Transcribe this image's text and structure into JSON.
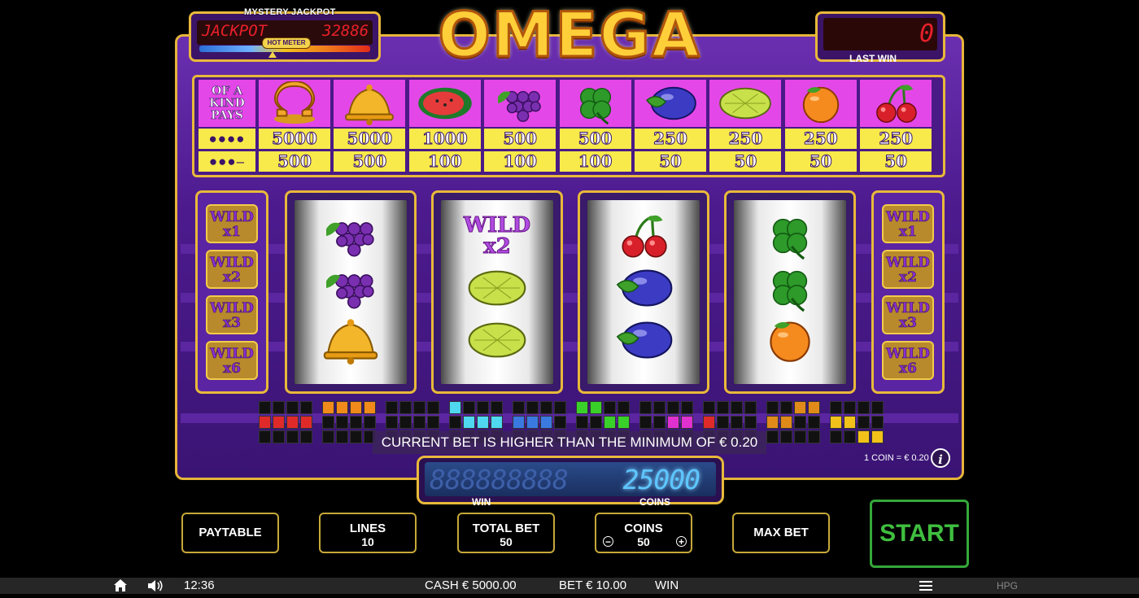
{
  "header": {
    "mystery_jackpot_title": "MYSTERY JACKPOT",
    "jackpot_label": "JACKPOT",
    "jackpot_value": "32886",
    "hot_meter_label": "HOT METER",
    "logo": "OMEGA",
    "last_win_value": "0",
    "last_win_label": "LAST WIN"
  },
  "paytable": {
    "kind_label": "OF A KIND PAYS",
    "row1_marker": "●●●●",
    "row2_marker": "●●●–",
    "symbols": [
      {
        "icon": "omega-icon",
        "five": "5000",
        "four": "500"
      },
      {
        "icon": "bell-icon",
        "five": "5000",
        "four": "500"
      },
      {
        "icon": "watermelon-icon",
        "five": "1000",
        "four": "100"
      },
      {
        "icon": "grapes-icon",
        "five": "500",
        "four": "100"
      },
      {
        "icon": "clover-icon",
        "five": "500",
        "four": "100"
      },
      {
        "icon": "plum-icon",
        "five": "250",
        "four": "50"
      },
      {
        "icon": "lemon-icon",
        "five": "250",
        "four": "50"
      },
      {
        "icon": "orange-icon",
        "five": "250",
        "four": "50"
      },
      {
        "icon": "cherry-icon",
        "five": "250",
        "four": "50"
      }
    ]
  },
  "wild_multipliers": {
    "left": [
      {
        "top": "WILD",
        "bot": "x1"
      },
      {
        "top": "WILD",
        "bot": "x2"
      },
      {
        "top": "WILD",
        "bot": "x3"
      },
      {
        "top": "WILD",
        "bot": "x6"
      }
    ],
    "right": [
      {
        "top": "WILD",
        "bot": "x1"
      },
      {
        "top": "WILD",
        "bot": "x2"
      },
      {
        "top": "WILD",
        "bot": "x3"
      },
      {
        "top": "WILD",
        "bot": "x6"
      }
    ]
  },
  "reels": [
    [
      "grapes-icon",
      "grapes-icon",
      "bell-icon"
    ],
    [
      "wild-x2",
      "lemon-icon",
      "lemon-icon"
    ],
    [
      "cherry-icon",
      "plum-icon",
      "plum-icon"
    ],
    [
      "clover-icon",
      "clover-icon",
      "orange-icon"
    ]
  ],
  "reel_wild": {
    "top": "WILD",
    "bot": "x2"
  },
  "message": "CURRENT BET IS HIGHER THAN THE MINIMUM OF € 0.20",
  "coin_rate": "1 COIN = € 0.20",
  "win_display": {
    "value": "25000",
    "ghost": "888888888",
    "win_label": "WIN",
    "coins_label": "COINS"
  },
  "buttons": {
    "paytable": "PAYTABLE",
    "lines_label": "LINES",
    "lines_value": "10",
    "total_bet_label": "TOTAL BET",
    "total_bet_value": "50",
    "coins_label": "COINS",
    "coins_value": "50",
    "max_bet": "MAX BET",
    "start": "START",
    "minus": "−",
    "plus": "+"
  },
  "status_bar": {
    "time": "12:36",
    "cash": "CASH € 5000.00",
    "bet": "BET € 10.00",
    "win": "WIN",
    "brand": "HPG"
  },
  "colors": {
    "cabinet": "#4c1a8d",
    "gold": "#e8b93a",
    "paytable_pink": "#e447e8",
    "paytable_yellow": "#f7ea4a",
    "start_green": "#3fbf3f"
  }
}
